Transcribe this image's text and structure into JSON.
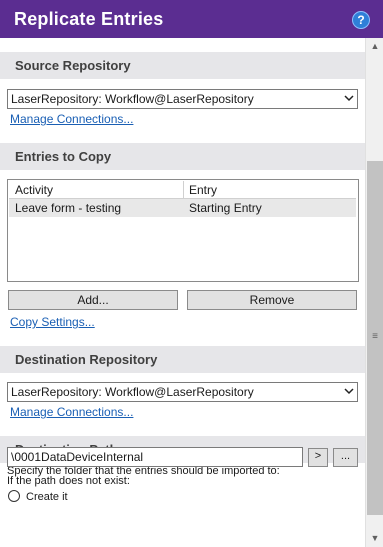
{
  "title": "Replicate Entries",
  "help_icon": "?",
  "source": {
    "header": "Source Repository",
    "select_value": "LaserRepository: Workflow@LaserRepository",
    "manage_link": "Manage Connections..."
  },
  "entries": {
    "header": "Entries to Copy",
    "columns": [
      "Activity",
      "Entry"
    ],
    "rows": [
      {
        "activity": "Leave form - testing",
        "entry": "Starting Entry"
      }
    ],
    "add_label": "Add...",
    "remove_label": "Remove",
    "copy_settings_link": "Copy Settings..."
  },
  "destination": {
    "header": "Destination Repository",
    "select_value": "LaserRepository: Workflow@LaserRepository",
    "manage_link": "Manage Connections..."
  },
  "path": {
    "header": "Destination Path",
    "prompt": "Specify the folder that the entries should be imported to:",
    "value": "\\0001DataDeviceInternal",
    "arrow_label": ">",
    "browse_label": "...",
    "not_exist_label": "If the path does not exist:",
    "create_label": "Create it"
  },
  "colors": {
    "title_bg": "#5b2d91",
    "section_bg": "#e6e6e9",
    "link": "#1a5fb4",
    "help": "#2f7fd8"
  },
  "icons": {
    "help": "help-icon",
    "dropdown": "chevron-down-icon",
    "scroll_up": "scroll-up-icon",
    "scroll_down": "scroll-down-icon",
    "grip": "grip-icon"
  }
}
